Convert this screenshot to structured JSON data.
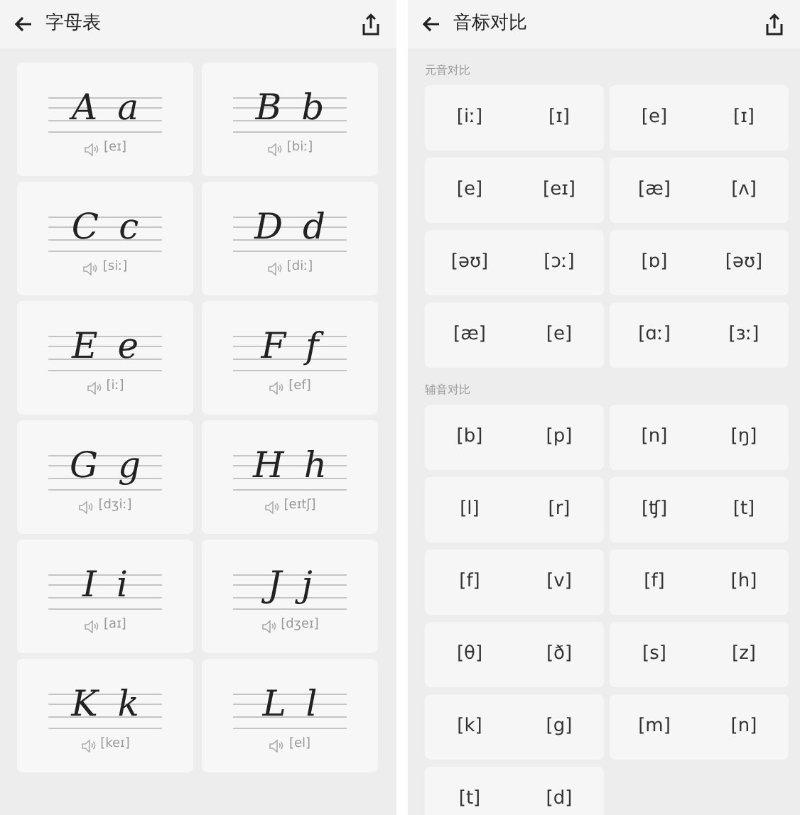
{
  "alphabet_screen": {
    "title": "字母表",
    "letters": [
      {
        "upper": "A",
        "lower": "a",
        "phonetic": "[eɪ]"
      },
      {
        "upper": "B",
        "lower": "b",
        "phonetic": "[biː]"
      },
      {
        "upper": "C",
        "lower": "c",
        "phonetic": "[siː]"
      },
      {
        "upper": "D",
        "lower": "d",
        "phonetic": "[diː]"
      },
      {
        "upper": "E",
        "lower": "e",
        "phonetic": "[iː]"
      },
      {
        "upper": "F",
        "lower": "f",
        "phonetic": "[ef]"
      },
      {
        "upper": "G",
        "lower": "g",
        "phonetic": "[dʒiː]"
      },
      {
        "upper": "H",
        "lower": "h",
        "phonetic": "[eɪtʃ]"
      },
      {
        "upper": "I",
        "lower": "i",
        "phonetic": "[aɪ]"
      },
      {
        "upper": "J",
        "lower": "j",
        "phonetic": "[dʒeɪ]"
      },
      {
        "upper": "K",
        "lower": "k",
        "phonetic": "[keɪ]"
      },
      {
        "upper": "L",
        "lower": "l",
        "phonetic": "[el]"
      }
    ]
  },
  "phonetics_screen": {
    "title": "音标对比",
    "sections": [
      {
        "label": "元音对比",
        "pairs": [
          [
            "[iː]",
            "[ɪ]"
          ],
          [
            "[e]",
            "[ɪ]"
          ],
          [
            "[e]",
            "[eɪ]"
          ],
          [
            "[æ]",
            "[ʌ]"
          ],
          [
            "[əʊ]",
            "[ɔː]"
          ],
          [
            "[ɒ]",
            "[əʊ]"
          ],
          [
            "[æ]",
            "[e]"
          ],
          [
            "[ɑː]",
            "[ɜː]"
          ]
        ]
      },
      {
        "label": "辅音对比",
        "pairs": [
          [
            "[b]",
            "[p]"
          ],
          [
            "[n]",
            "[ŋ]"
          ],
          [
            "[l]",
            "[r]"
          ],
          [
            "[ʧ]",
            "[t]"
          ],
          [
            "[f]",
            "[v]"
          ],
          [
            "[f]",
            "[h]"
          ],
          [
            "[θ]",
            "[ð]"
          ],
          [
            "[s]",
            "[z]"
          ],
          [
            "[k]",
            "[g]"
          ],
          [
            "[m]",
            "[n]"
          ],
          [
            "[t]",
            "[d]"
          ]
        ]
      }
    ]
  }
}
